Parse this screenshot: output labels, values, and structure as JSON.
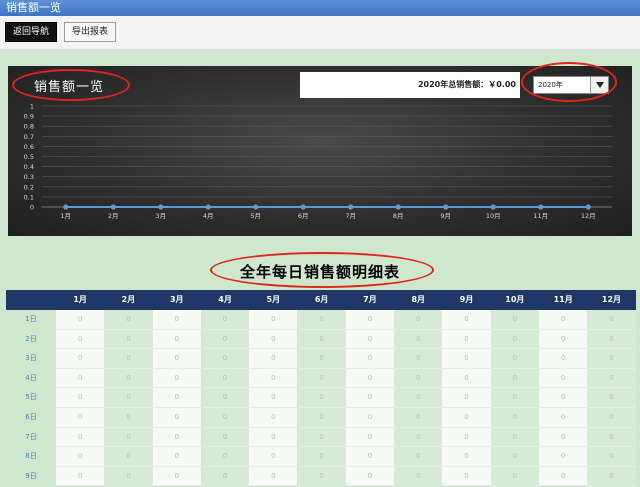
{
  "window": {
    "title": "销售额一览"
  },
  "toolbar": {
    "back_label": "返回导航",
    "export_label": "导出报表"
  },
  "chart_panel": {
    "title": "销售额一览",
    "total_text": "2020年总销售额：￥0.00",
    "year_selected": "2020年"
  },
  "chart_data": {
    "type": "line",
    "categories": [
      "1月",
      "2月",
      "3月",
      "4月",
      "5月",
      "6月",
      "7月",
      "8月",
      "9月",
      "10月",
      "11月",
      "12月"
    ],
    "values": [
      0,
      0,
      0,
      0,
      0,
      0,
      0,
      0,
      0,
      0,
      0,
      0
    ],
    "yticks": [
      "0",
      "0.1",
      "0.2",
      "0.3",
      "0.4",
      "0.5",
      "0.6",
      "0.7",
      "0.8",
      "0.9",
      "1"
    ],
    "ylim": [
      0,
      1
    ],
    "grid": true,
    "line_color": "#5b9bd5"
  },
  "table": {
    "title": "全年每日销售额明细表",
    "columns": [
      "1月",
      "2月",
      "3月",
      "4月",
      "5月",
      "6月",
      "7月",
      "8月",
      "9月",
      "10月",
      "11月",
      "12月"
    ],
    "rows": [
      {
        "label": "1日",
        "values": [
          "0",
          "0",
          "0",
          "0",
          "0",
          "0",
          "0",
          "0",
          "0",
          "0",
          "0",
          "0"
        ]
      },
      {
        "label": "2日",
        "values": [
          "0",
          "0",
          "0",
          "0",
          "0",
          "0",
          "0",
          "0",
          "0",
          "0",
          "0",
          "0"
        ]
      },
      {
        "label": "3日",
        "values": [
          "0",
          "0",
          "0",
          "0",
          "0",
          "0",
          "0",
          "0",
          "0",
          "0",
          "0",
          "0"
        ]
      },
      {
        "label": "4日",
        "values": [
          "0",
          "0",
          "0",
          "0",
          "0",
          "0",
          "0",
          "0",
          "0",
          "0",
          "0",
          "0"
        ]
      },
      {
        "label": "5日",
        "values": [
          "0",
          "0",
          "0",
          "0",
          "0",
          "0",
          "0",
          "0",
          "0",
          "0",
          "0",
          "0"
        ]
      },
      {
        "label": "6日",
        "values": [
          "0",
          "0",
          "0",
          "0",
          "0",
          "0",
          "0",
          "0",
          "0",
          "0",
          "0",
          "0"
        ]
      },
      {
        "label": "7日",
        "values": [
          "0",
          "0",
          "0",
          "0",
          "0",
          "0",
          "0",
          "0",
          "0",
          "0",
          "0",
          "0"
        ]
      },
      {
        "label": "8日",
        "values": [
          "0",
          "0",
          "0",
          "0",
          "0",
          "0",
          "0",
          "0",
          "0",
          "0",
          "0",
          "0"
        ]
      },
      {
        "label": "9日",
        "values": [
          "0",
          "0",
          "0",
          "0",
          "0",
          "0",
          "0",
          "0",
          "0",
          "0",
          "0",
          "0"
        ]
      }
    ]
  },
  "colors": {
    "header_bg": "#1e3766",
    "page_bg": "#cfe6cf",
    "annotation": "#e0251a"
  }
}
